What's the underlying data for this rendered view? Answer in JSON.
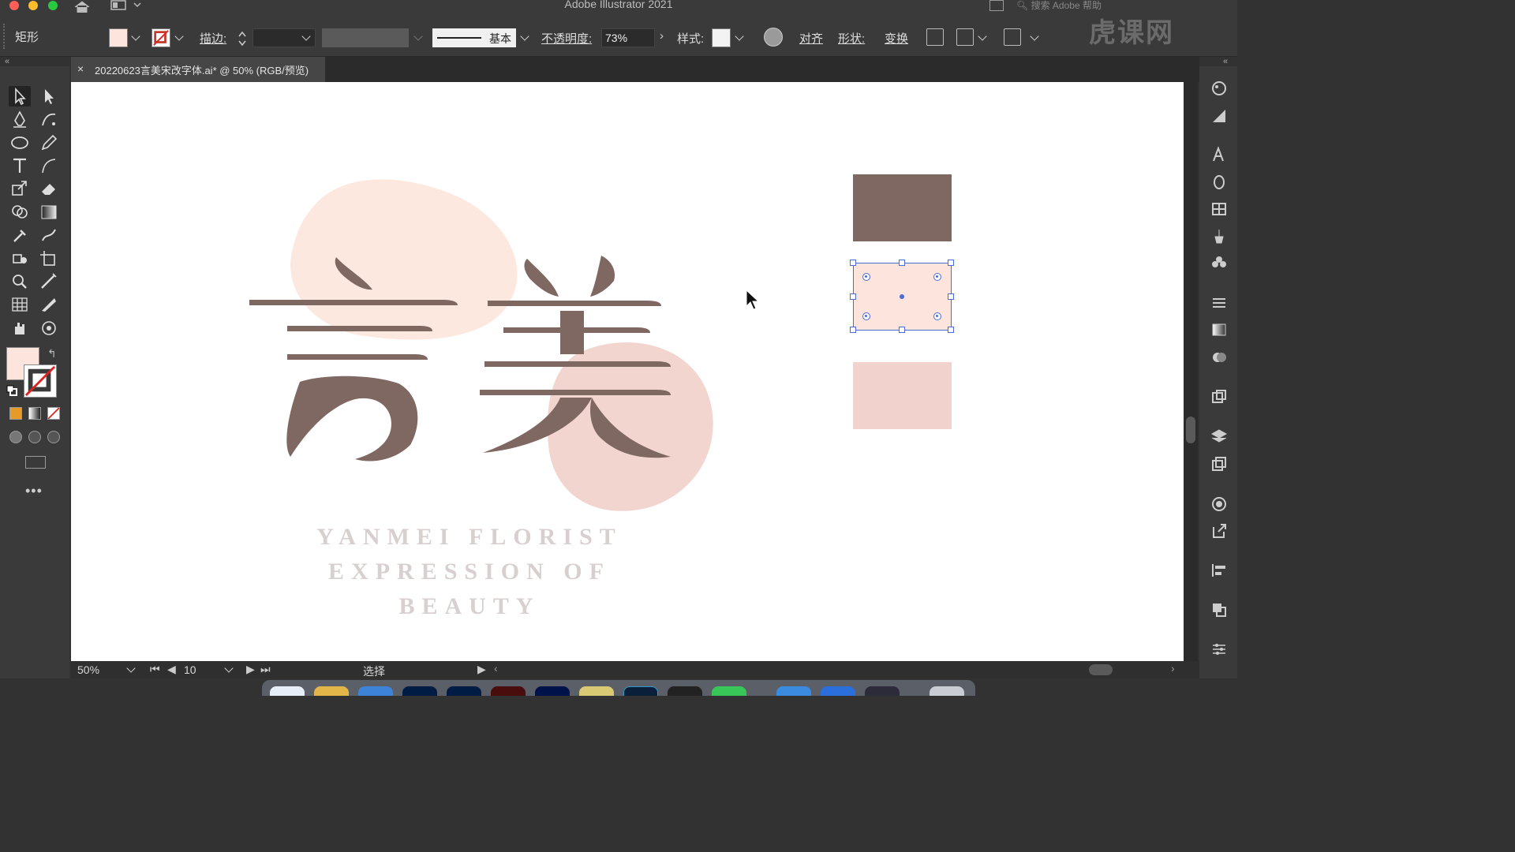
{
  "window": {
    "title": "Adobe Illustrator 2021",
    "search_placeholder": "搜索 Adobe 帮助"
  },
  "control_bar": {
    "object_type": "矩形",
    "stroke_label": "描边:",
    "brush": "基本",
    "opacity_label": "不透明度:",
    "opacity_value": "73%",
    "style_label": "样式:",
    "align_label": "对齐",
    "shape_label": "形状:",
    "transform_label": "变换"
  },
  "document": {
    "tab_title": "20220623言美宋改字体.ai* @ 50% (RGB/预览)"
  },
  "artwork": {
    "logo_text": "言美",
    "tagline_lines": [
      "YANMEI FLORIST",
      "EXPRESSION OF",
      "BEAUTY"
    ]
  },
  "colors": {
    "brown": "#7f6762",
    "peach": "#fde4dc",
    "pink": "#f2d2cc",
    "blob_peach": "#fde8df",
    "blob_pink": "#f2d5cf",
    "selection": "#4c6bd6"
  },
  "status_bar": {
    "zoom": "50%",
    "artboard": "10",
    "status": "选择"
  },
  "watermark": "虎课网"
}
